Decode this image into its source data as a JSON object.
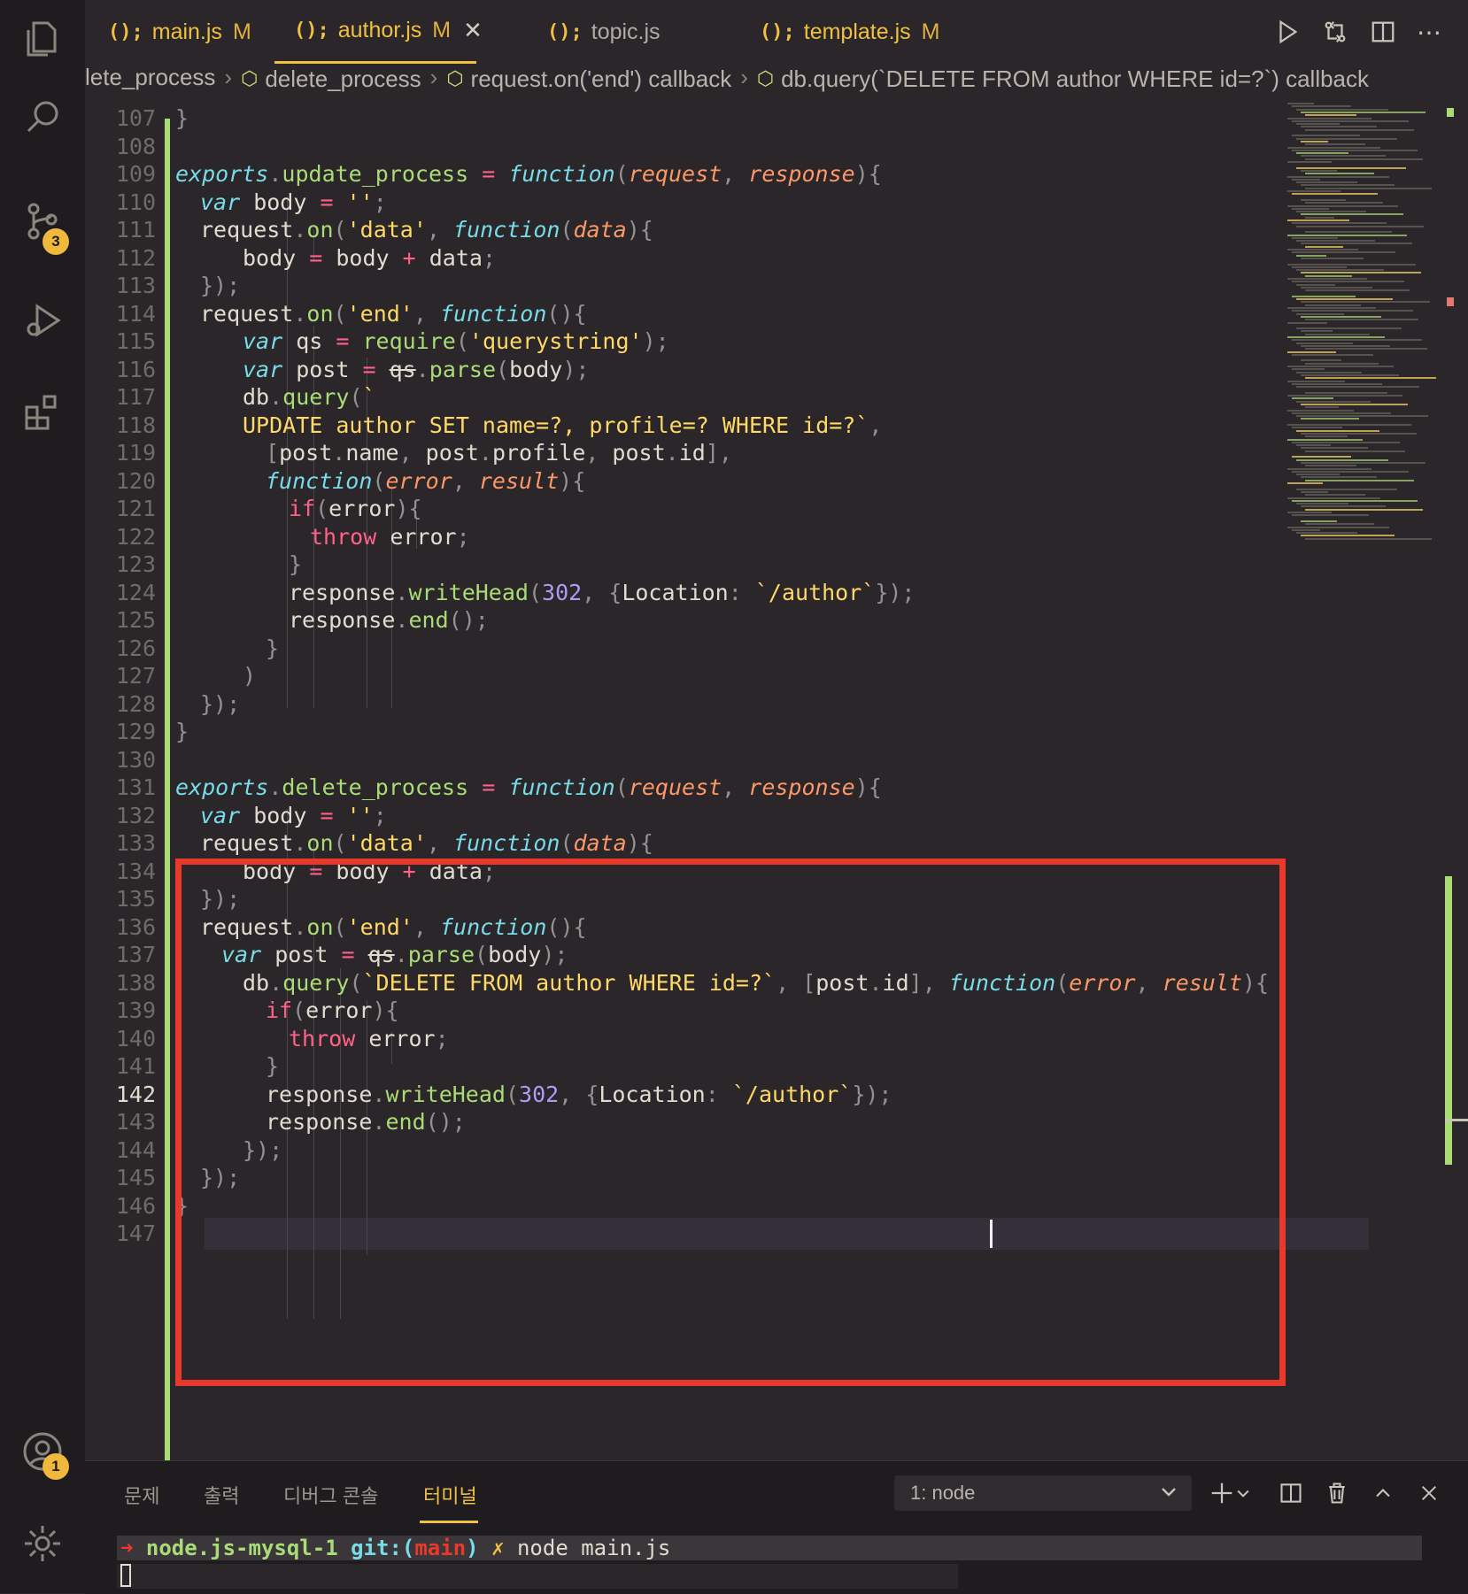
{
  "tabs": [
    {
      "icon": "();",
      "name": "main.js",
      "status": "M"
    },
    {
      "icon": "();",
      "name": "author.js",
      "status": "M"
    },
    {
      "icon": "();",
      "name": "topic.js",
      "status": ""
    },
    {
      "icon": "();",
      "name": "template.js",
      "status": "M"
    }
  ],
  "breadcrumb": [
    "lete_process",
    "delete_process",
    "request.on('end') callback",
    "db.query(`DELETE FROM author WHERE id=?`) callback"
  ],
  "activity": {
    "source_control_badge": "3",
    "account_badge": "1"
  },
  "editor": {
    "current_line": "142"
  },
  "panel": {
    "tabs": [
      "문제",
      "출력",
      "디버그 콘솔",
      "터미널"
    ],
    "terminal_select": "1: node",
    "terminal": {
      "arrow": "➜",
      "dir": "node.js-mysql-1",
      "git": "git:(",
      "branch": "main",
      "git_close": ")",
      "x": "✗",
      "command": "node main.js"
    }
  },
  "colors": {
    "accent": "#f0c040",
    "highlight_box": "#e8392a",
    "gutter_modified": "#a9dc76"
  }
}
